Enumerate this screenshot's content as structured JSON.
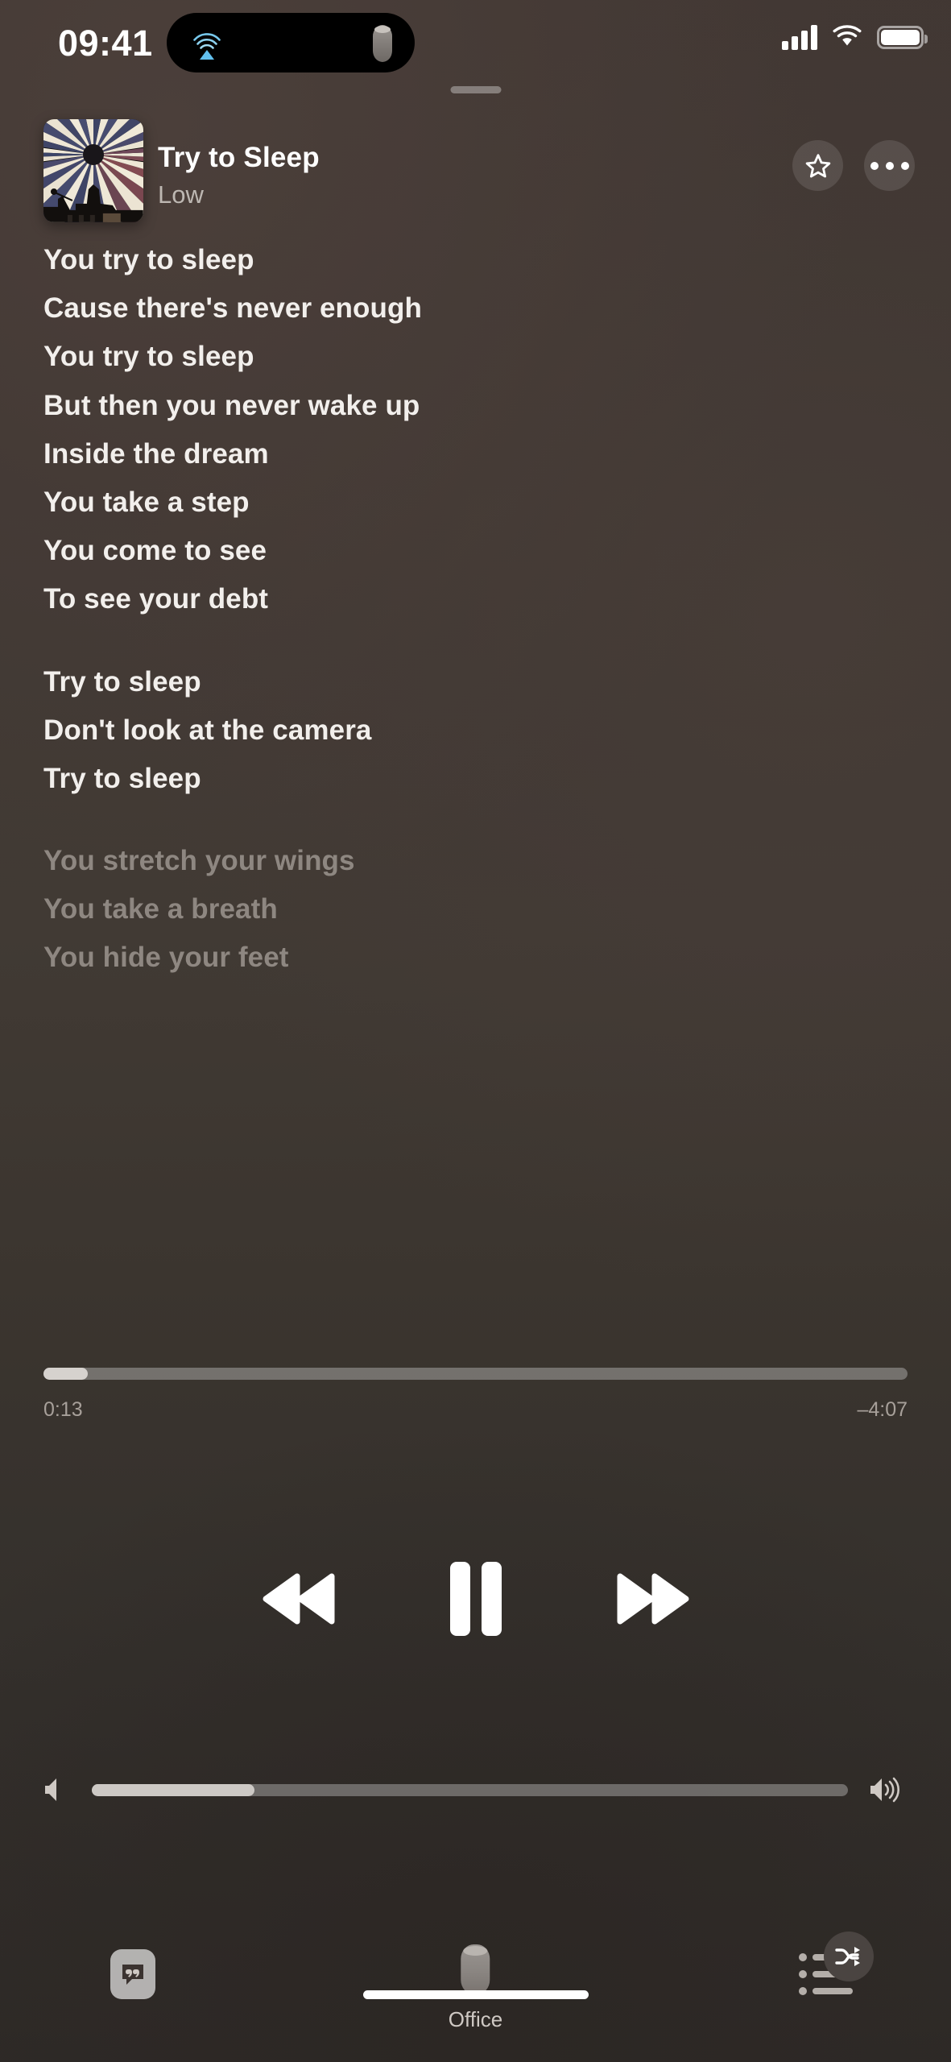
{
  "status_bar": {
    "time": "09:41",
    "icons": {
      "dynamic_island_left": "airplay-icon",
      "dynamic_island_right": "homepod-icon",
      "cellular": "cellular-signal-icon",
      "wifi": "wifi-icon",
      "battery": "battery-icon"
    },
    "accent_airplay": "#6ec6f0"
  },
  "now_playing": {
    "title": "Try to Sleep",
    "artist": "Low",
    "artwork_name": "album-artwork-starburst",
    "favorite_icon": "star-icon",
    "more_icon": "ellipsis-icon"
  },
  "lyrics": {
    "lines": [
      {
        "text": "You try to sleep",
        "state": "sung"
      },
      {
        "text": "Cause there's never enough",
        "state": "sung"
      },
      {
        "text": "You try to sleep",
        "state": "sung"
      },
      {
        "text": "But then you never wake up",
        "state": "sung"
      },
      {
        "text": "Inside the dream",
        "state": "sung"
      },
      {
        "text": "You take a step",
        "state": "sung"
      },
      {
        "text": "You come to see",
        "state": "sung"
      },
      {
        "text": "To see your debt",
        "state": "sung"
      },
      {
        "text": "",
        "state": "blank"
      },
      {
        "text": "Try to sleep",
        "state": "sung"
      },
      {
        "text": "Don't look at the camera",
        "state": "sung"
      },
      {
        "text": "Try to sleep",
        "state": "sung"
      },
      {
        "text": "",
        "state": "blank"
      },
      {
        "text": "You stretch your wings",
        "state": "upcoming"
      },
      {
        "text": "You take a breath",
        "state": "upcoming"
      },
      {
        "text": "You hide your feet",
        "state": "upcoming"
      }
    ]
  },
  "progress": {
    "elapsed": "0:13",
    "remaining": "–4:07",
    "percent": 5.1
  },
  "transport": {
    "previous_icon": "rewind-icon",
    "play_pause_icon": "pause-icon",
    "next_icon": "fast-forward-icon",
    "state": "playing"
  },
  "volume": {
    "percent": 21.5,
    "min_icon": "speaker-low-icon",
    "max_icon": "speaker-high-icon"
  },
  "bottom_bar": {
    "lyrics_icon": "lyrics-quote-icon",
    "output_icon": "homepod-icon",
    "output_label": "Office",
    "queue_icon": "queue-list-icon",
    "shuffle_icon": "shuffle-icon",
    "home_indicator": "home-indicator"
  },
  "colors": {
    "background_top": "#413733",
    "background_bottom": "#2e2a27",
    "text_primary": "#ffffff",
    "text_secondary": "#bdb7b2",
    "lyric_sung": "#f2efec",
    "lyric_upcoming": "#8e8781",
    "slider_fill": "#d6d2ce",
    "slider_track": "rgba(255,255,255,0.30)"
  }
}
